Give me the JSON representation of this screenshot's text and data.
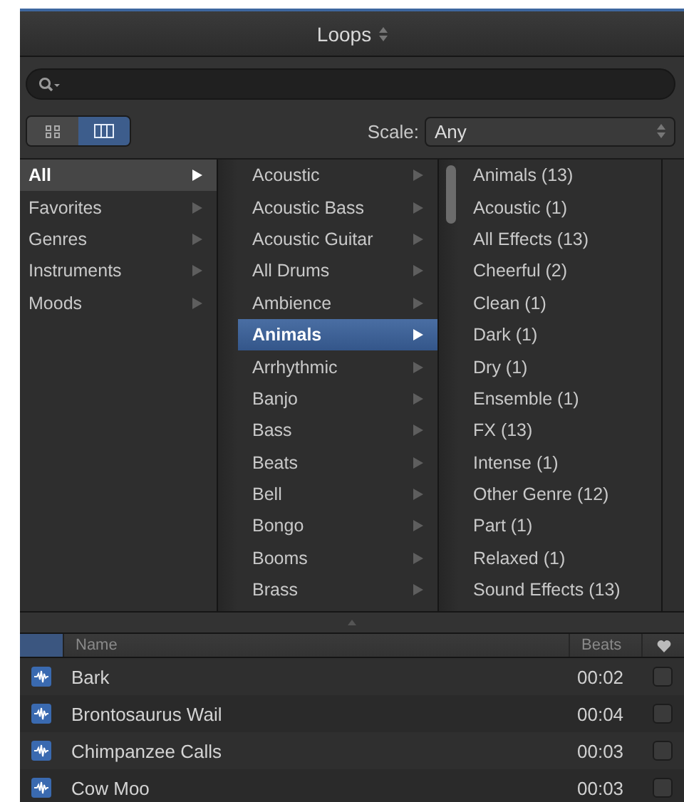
{
  "window": {
    "title": "Loops"
  },
  "view_buttons": [
    {
      "kind": "grid",
      "selected": false
    },
    {
      "kind": "columns",
      "selected": true
    }
  ],
  "scale": {
    "label": "Scale:",
    "value": "Any"
  },
  "browser": {
    "columns": [
      {
        "items": [
          {
            "label": "All",
            "selected": true
          },
          {
            "label": "Favorites",
            "selected": false
          },
          {
            "label": "Genres",
            "selected": false
          },
          {
            "label": "Instruments",
            "selected": false
          },
          {
            "label": "Moods",
            "selected": false
          }
        ]
      },
      {
        "items": [
          {
            "label": "Acoustic",
            "selected": false
          },
          {
            "label": "Acoustic Bass",
            "selected": false
          },
          {
            "label": "Acoustic Guitar",
            "selected": false
          },
          {
            "label": "All Drums",
            "selected": false
          },
          {
            "label": "Ambience",
            "selected": false
          },
          {
            "label": "Animals",
            "selected": true
          },
          {
            "label": "Arrhythmic",
            "selected": false
          },
          {
            "label": "Banjo",
            "selected": false
          },
          {
            "label": "Bass",
            "selected": false
          },
          {
            "label": "Beats",
            "selected": false
          },
          {
            "label": "Bell",
            "selected": false
          },
          {
            "label": "Bongo",
            "selected": false
          },
          {
            "label": "Booms",
            "selected": false
          },
          {
            "label": "Brass",
            "selected": false
          }
        ]
      },
      {
        "items": [
          {
            "label": "Animals (13)",
            "selected": false
          },
          {
            "label": "Acoustic (1)",
            "selected": false
          },
          {
            "label": "All Effects (13)",
            "selected": false
          },
          {
            "label": "Cheerful (2)",
            "selected": false
          },
          {
            "label": "Clean (1)",
            "selected": false
          },
          {
            "label": "Dark (1)",
            "selected": false
          },
          {
            "label": "Dry (1)",
            "selected": false
          },
          {
            "label": "Ensemble (1)",
            "selected": false
          },
          {
            "label": "FX (13)",
            "selected": false
          },
          {
            "label": "Intense (1)",
            "selected": false
          },
          {
            "label": "Other Genre (12)",
            "selected": false
          },
          {
            "label": "Part (1)",
            "selected": false
          },
          {
            "label": "Relaxed (1)",
            "selected": false
          },
          {
            "label": "Sound Effects (13)",
            "selected": false
          }
        ]
      }
    ]
  },
  "table": {
    "columns": [
      "Name",
      "Beats"
    ],
    "rows": [
      {
        "name": "Bark",
        "beats": "00:02",
        "favorite": false
      },
      {
        "name": "Brontosaurus Wail",
        "beats": "00:04",
        "favorite": false
      },
      {
        "name": "Chimpanzee Calls",
        "beats": "00:03",
        "favorite": false
      },
      {
        "name": "Cow Moo",
        "beats": "00:03",
        "favorite": false
      }
    ]
  }
}
